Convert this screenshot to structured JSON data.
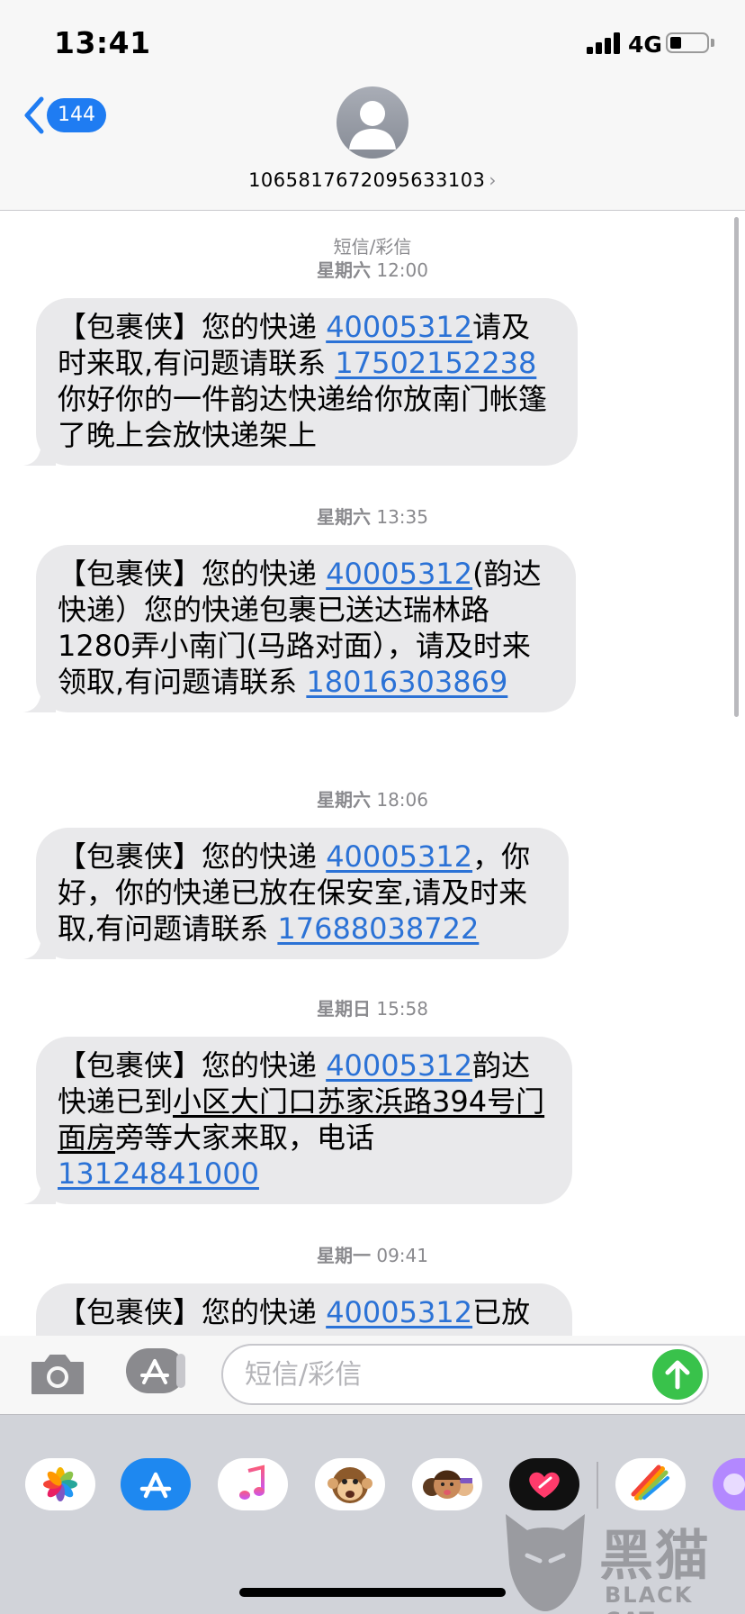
{
  "status_bar": {
    "time": "13:41",
    "network": "4G"
  },
  "header": {
    "back_badge": "144",
    "contact_number": "1065817672095633103",
    "contact_chevron": "›"
  },
  "conversation": {
    "service_label": "短信/彩信",
    "messages": [
      {
        "timestamp_day": "星期六",
        "timestamp_time": "12:00",
        "prefix": "【包裹侠】您的快递 ",
        "tracking": "40005312",
        "mid": "请及时来取,有问题请联系 ",
        "phone": "17502152238",
        "suffix": "你好你的一件韵达快递给你放南门帐篷了晚上会放快递架上"
      },
      {
        "timestamp_day": "星期六",
        "timestamp_time": "13:35",
        "prefix": "【包裹侠】您的快递 ",
        "tracking": "40005312",
        "mid": "(韵达快递）您的快递包裹已送达瑞林路1280弄小南门(马路对面），请及时来领取,有问题请联系 ",
        "phone": "18016303869",
        "suffix": ""
      },
      {
        "timestamp_day": "星期六",
        "timestamp_time": "18:06",
        "prefix": "【包裹侠】您的快递 ",
        "tracking": "40005312",
        "mid": "，你好，你的快递已放在保安室,请及时来取,有问题请联系 ",
        "phone": "17688038722",
        "suffix": ""
      },
      {
        "timestamp_day": "星期日",
        "timestamp_time": "15:58",
        "prefix": "【包裹侠】您的快递 ",
        "tracking": "40005312",
        "mid_a": "韵达快递已到",
        "address": "小区大门口苏家浜路394号门面房",
        "mid_b": "旁等大家来取，电话 ",
        "phone": "13124841000",
        "suffix": ""
      },
      {
        "timestamp_day": "星期一",
        "timestamp_time": "09:41",
        "prefix": "【包裹侠】您的快递 ",
        "tracking": "40005312",
        "mid": "已放",
        "phone": "",
        "suffix": ""
      }
    ]
  },
  "input_bar": {
    "placeholder": "短信/彩信"
  },
  "app_drawer": {
    "apps": [
      "photos-icon",
      "app-store-icon",
      "music-icon",
      "animoji-monkey-icon",
      "memoji-icon",
      "digital-touch-icon",
      "stickers-icon",
      "more-app-icon"
    ]
  },
  "watermark": {
    "text": "黑猫",
    "sub": "BLACK CAT"
  },
  "colors": {
    "link": "#2b72d6",
    "bubble": "#e9e9eb",
    "badge": "#1f7cf2",
    "send": "#39c24b"
  }
}
